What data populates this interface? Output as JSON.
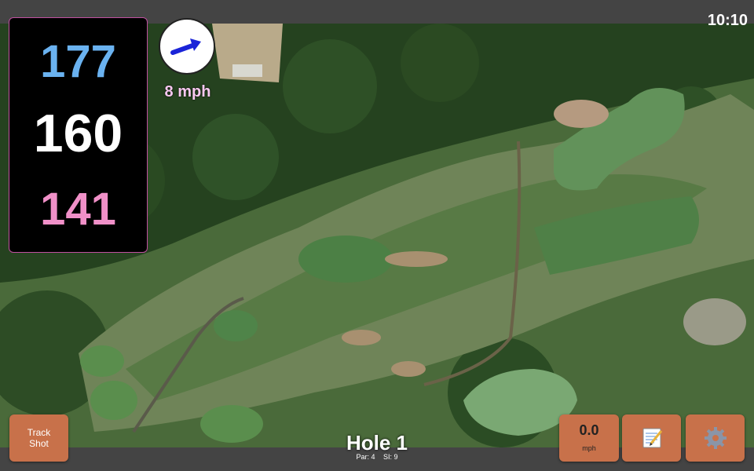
{
  "status": {
    "time": "10:10"
  },
  "distances": {
    "back": "177",
    "middle": "160",
    "front": "141"
  },
  "wind": {
    "speed_label": "8 mph",
    "direction_icon": "arrow-icon"
  },
  "hole": {
    "title": "Hole 1",
    "par": "Par: 4",
    "stroke_index": "SI: 9"
  },
  "buttons": {
    "track_shot": "Track Shot",
    "speed_value": "0.0",
    "speed_unit": "mph",
    "notes_icon": "notepad-icon",
    "settings_icon": "gear-icon"
  },
  "colors": {
    "back": "#6ab2f0",
    "middle": "#ffffff",
    "front": "#f090c8",
    "button": "#c8714a"
  }
}
